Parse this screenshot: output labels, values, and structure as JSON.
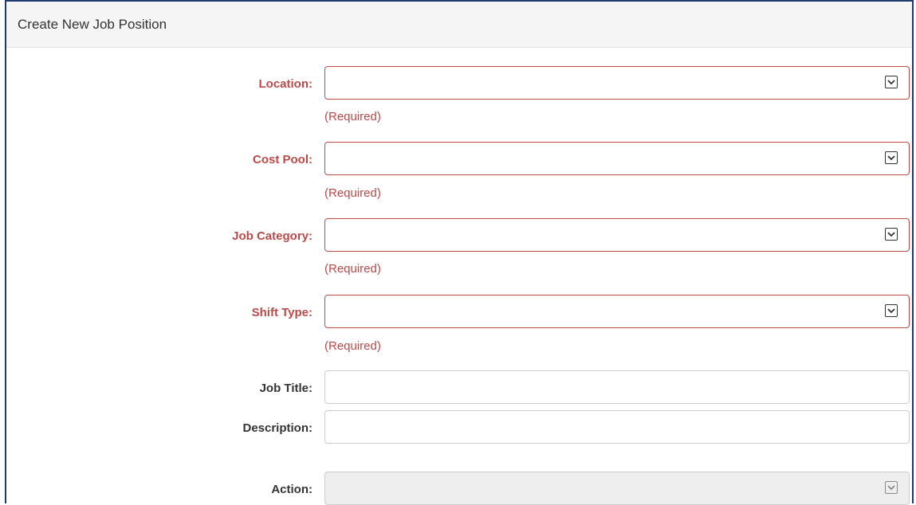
{
  "panel": {
    "title": "Create New Job Position"
  },
  "fields": [
    {
      "label": "Location:",
      "help": "(Required)"
    },
    {
      "label": "Cost Pool:",
      "help": "(Required)"
    },
    {
      "label": "Job Category:",
      "help": "(Required)"
    },
    {
      "label": "Shift Type:",
      "help": "(Required)"
    },
    {
      "label": "Job Title:",
      "value": ""
    },
    {
      "label": "Description:",
      "value": ""
    },
    {
      "label": "Action:",
      "value": ""
    }
  ],
  "icons": {
    "dropdown": "chevron-down-icon"
  },
  "colors": {
    "required": "#b94a48",
    "border": "#1f3a6e"
  }
}
